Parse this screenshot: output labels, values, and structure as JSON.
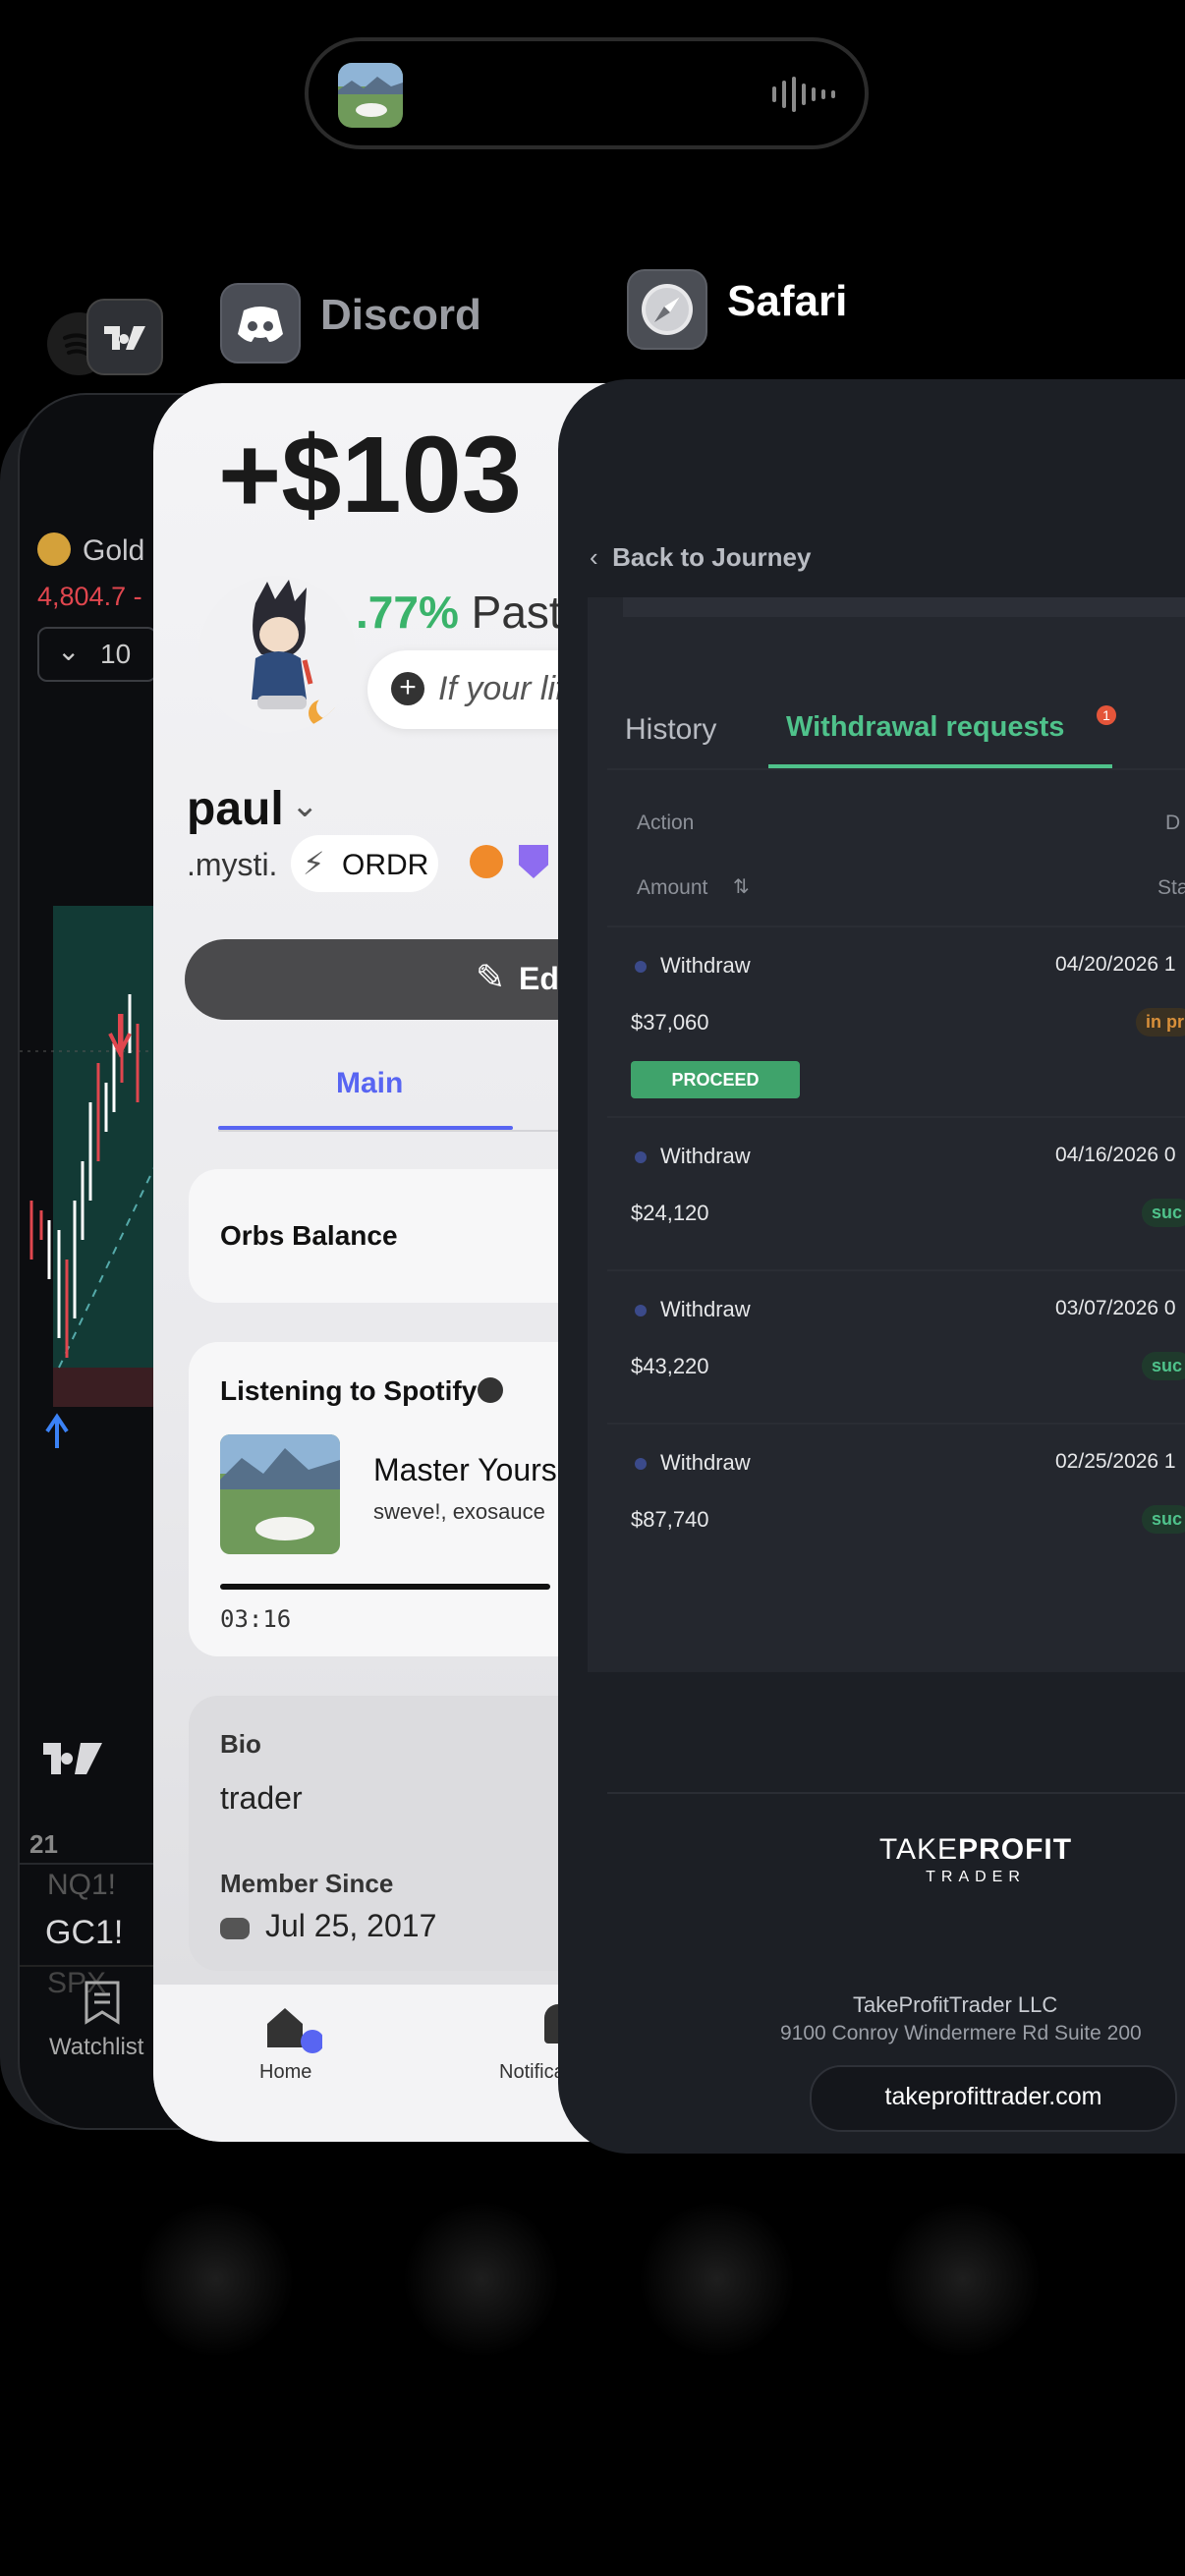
{
  "switcher": {
    "apps": [
      {
        "name": "Discord"
      },
      {
        "name": "Safari"
      }
    ]
  },
  "tradingview": {
    "symbol_label": "Gold",
    "price": "4,804.7 -",
    "interval": "10",
    "axis_label": "21",
    "watch_items": [
      "NQ1!",
      "GC1!",
      "SPX"
    ],
    "watchlist_tab": "Watchlist"
  },
  "discord": {
    "pnl_text": "+$103",
    "pct_text": ".77%",
    "pct_suffix": "Past",
    "status_prompt": "If your lif",
    "username": "paul",
    "handle": ".mysti.",
    "clan_tag": "ORDR",
    "edit_label": "Edit",
    "tab_main": "Main",
    "orbs_label": "Orbs Balance",
    "spotify_heading": "Listening to Spotify",
    "track_title": "Master Yours",
    "track_artists": "sweve!, exosauce",
    "track_time": "03:16",
    "bio_label": "Bio",
    "bio_text": "trader",
    "member_since_label": "Member Since",
    "member_since_date": "Jul 25, 2017",
    "nav_home": "Home",
    "nav_notifications": "Notifica"
  },
  "safari": {
    "back_label": "Back to Journey",
    "tab_history": "History",
    "tab_withdrawals": "Withdrawal requests",
    "withdraw_badge": "1",
    "col_action": "Action",
    "col_d": "D",
    "col_amount": "Amount",
    "col_status": "Sta",
    "rows": [
      {
        "action": "Withdraw",
        "date": "04/20/2026 1",
        "amount": "$37,060",
        "status": "in pr",
        "button": "PROCEED"
      },
      {
        "action": "Withdraw",
        "date": "04/16/2026 0",
        "amount": "$24,120",
        "status": "suc"
      },
      {
        "action": "Withdraw",
        "date": "03/07/2026 0",
        "amount": "$43,220",
        "status": "suc"
      },
      {
        "action": "Withdraw",
        "date": "02/25/2026 1",
        "amount": "$87,740",
        "status": "suc"
      }
    ],
    "logo_take": "TAKE",
    "logo_profit": "PROFIT",
    "logo_trader": "TRADER",
    "company_name": "TakeProfitTrader LLC",
    "company_address": "9100 Conroy Windermere Rd Suite 200",
    "url": "takeprofittrader.com"
  },
  "colors": {
    "accent_green": "#4fc28b",
    "proceed_green": "#3fa36b",
    "discord_blurple": "#5865f2",
    "loss_red": "#e0464e",
    "warn_orange": "#d9903a"
  }
}
